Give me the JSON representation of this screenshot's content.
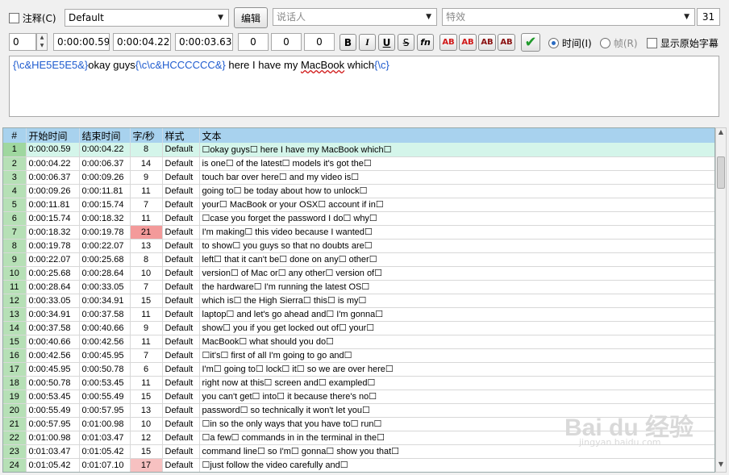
{
  "toolbar": {
    "comment_label": "注释(C)",
    "style_value": "Default",
    "edit_label": "编辑",
    "actor_placeholder": "说话人",
    "effect_placeholder": "特效",
    "layer_value": "31",
    "spin_value": "0",
    "start_time": "0:00:00.59",
    "end_time": "0:00:04.22",
    "duration": "0:00:03.63",
    "margin_l": "0",
    "margin_r": "0",
    "margin_v": "0",
    "bold": "B",
    "italic": "I",
    "underline": "U",
    "strike": "S",
    "fn": "fn",
    "ab_label": "AB",
    "time_label": "时间(I)",
    "frame_label": "帧(R)",
    "show_original_label": "显示原始字幕"
  },
  "editor": {
    "seg1_tag": "{\\c&HE5E5E5&}",
    "seg1_text": "okay guys",
    "seg2_tag": "{\\c\\c&HCCCCCC&}",
    "seg2_text": " here I have my ",
    "seg2_word": "MacBook",
    "seg2_tail": " which",
    "seg3_tag": "{\\c}"
  },
  "grid": {
    "headers": [
      "#",
      "开始时间",
      "结束时间",
      "字/秒",
      "样式",
      "文本"
    ],
    "rows": [
      [
        "1",
        "0:00:00.59",
        "0:00:04.22",
        "8",
        "Default",
        "☐okay guys☐ here I have my MacBook which☐"
      ],
      [
        "2",
        "0:00:04.22",
        "0:00:06.37",
        "14",
        "Default",
        "is one☐ of the latest☐ models it's got the☐"
      ],
      [
        "3",
        "0:00:06.37",
        "0:00:09.26",
        "9",
        "Default",
        "touch bar over here☐ and my video is☐"
      ],
      [
        "4",
        "0:00:09.26",
        "0:00:11.81",
        "11",
        "Default",
        "going to☐ be today about how to unlock☐"
      ],
      [
        "5",
        "0:00:11.81",
        "0:00:15.74",
        "7",
        "Default",
        "your☐ MacBook or your OSX☐ account if in☐"
      ],
      [
        "6",
        "0:00:15.74",
        "0:00:18.32",
        "11",
        "Default",
        "☐case you forget the password I do☐ why☐"
      ],
      [
        "7",
        "0:00:18.32",
        "0:00:19.78",
        "21",
        "Default",
        "I'm making☐ this video because I wanted☐"
      ],
      [
        "8",
        "0:00:19.78",
        "0:00:22.07",
        "13",
        "Default",
        "to show☐ you guys so that no doubts are☐"
      ],
      [
        "9",
        "0:00:22.07",
        "0:00:25.68",
        "8",
        "Default",
        "left☐ that it can't be☐ done on any☐ other☐"
      ],
      [
        "10",
        "0:00:25.68",
        "0:00:28.64",
        "10",
        "Default",
        "version☐ of Mac or☐ any other☐ version of☐"
      ],
      [
        "11",
        "0:00:28.64",
        "0:00:33.05",
        "7",
        "Default",
        "the hardware☐ I'm running the latest OS☐"
      ],
      [
        "12",
        "0:00:33.05",
        "0:00:34.91",
        "15",
        "Default",
        "which is☐ the High Sierra☐ this☐ is my☐"
      ],
      [
        "13",
        "0:00:34.91",
        "0:00:37.58",
        "11",
        "Default",
        "laptop☐ and let's go ahead and☐ I'm gonna☐"
      ],
      [
        "14",
        "0:00:37.58",
        "0:00:40.66",
        "9",
        "Default",
        "show☐ you if you get locked out of☐ your☐"
      ],
      [
        "15",
        "0:00:40.66",
        "0:00:42.56",
        "11",
        "Default",
        "MacBook☐ what should you do☐"
      ],
      [
        "16",
        "0:00:42.56",
        "0:00:45.95",
        "7",
        "Default",
        "☐it's☐ first of all I'm going to go and☐"
      ],
      [
        "17",
        "0:00:45.95",
        "0:00:50.78",
        "6",
        "Default",
        "I'm☐ going to☐ lock☐ it☐ so we are over here☐"
      ],
      [
        "18",
        "0:00:50.78",
        "0:00:53.45",
        "11",
        "Default",
        "right now at this☐ screen and☐ exampled☐"
      ],
      [
        "19",
        "0:00:53.45",
        "0:00:55.49",
        "15",
        "Default",
        "you can't get☐ into☐ it because there's no☐"
      ],
      [
        "20",
        "0:00:55.49",
        "0:00:57.95",
        "13",
        "Default",
        "password☐ so technically it won't let you☐"
      ],
      [
        "21",
        "0:00:57.95",
        "0:01:00.98",
        "10",
        "Default",
        "☐in so the only ways that you have to☐ run☐"
      ],
      [
        "22",
        "0:01:00.98",
        "0:01:03.47",
        "12",
        "Default",
        "☐a few☐ commands in in the terminal in the☐"
      ],
      [
        "23",
        "0:01:03.47",
        "0:01:05.42",
        "15",
        "Default",
        "command line☐ so I'm☐ gonna☐ show you that☐"
      ],
      [
        "24",
        "0:01:05.42",
        "0:01:07.10",
        "17",
        "Default",
        "☐just follow the video carefully and☐"
      ]
    ]
  },
  "watermark": {
    "logo": "Bai du 经验",
    "url": "jingyan.baidu.com"
  },
  "colors": {
    "header_bg": "#a8d2ee",
    "row_num_bg": "#b6e0b6",
    "selected_row_bg": "#d4f5ea",
    "cps_high": "#f39a9a",
    "cps_warn": "#f7c1c1",
    "override_tag": "#1f5ccf",
    "override_code": "#1c8a2e"
  }
}
